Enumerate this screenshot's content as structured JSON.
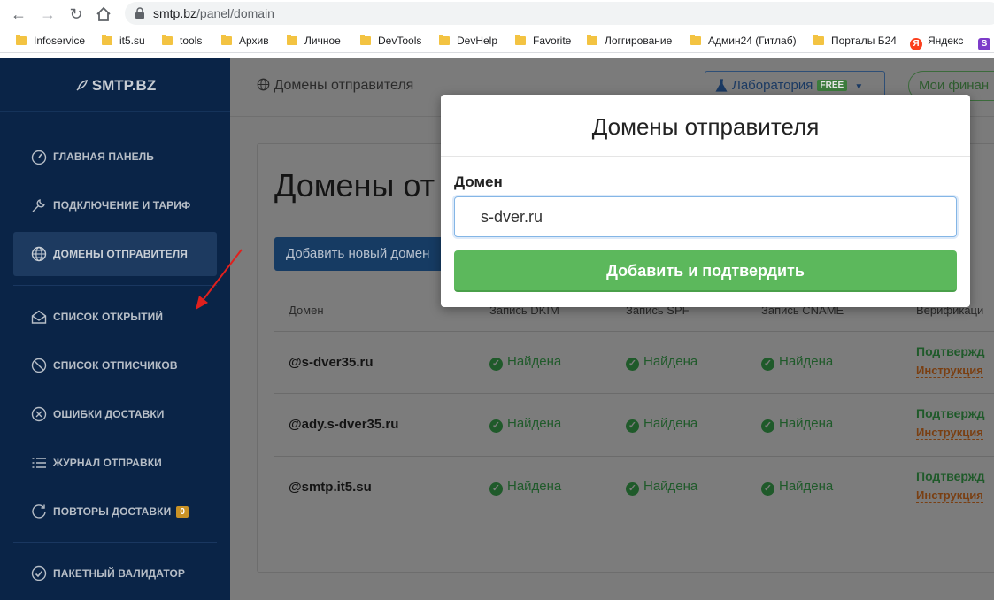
{
  "browser": {
    "url_host": "smtp.bz",
    "url_path": "/panel/domain",
    "bookmarks": [
      {
        "label": "Infoservice",
        "type": "folder"
      },
      {
        "label": "it5.su",
        "type": "folder"
      },
      {
        "label": "tools",
        "type": "folder"
      },
      {
        "label": "Архив",
        "type": "folder"
      },
      {
        "label": "Личное",
        "type": "folder"
      },
      {
        "label": "DevTools",
        "type": "folder"
      },
      {
        "label": "DevHelp",
        "type": "folder"
      },
      {
        "label": "Favorite",
        "type": "folder"
      },
      {
        "label": "Логгирование",
        "type": "folder"
      },
      {
        "label": "Админ24 (Гитлаб)",
        "type": "folder"
      },
      {
        "label": "Порталы Б24",
        "type": "folder"
      },
      {
        "label": "Яндекс",
        "type": "yandex"
      }
    ]
  },
  "sidebar": {
    "logo": "SMTP.BZ",
    "items": [
      {
        "label": "ГЛАВНАЯ ПАНЕЛЬ",
        "icon": "gauge-icon"
      },
      {
        "label": "ПОДКЛЮЧЕНИЕ И ТАРИФ",
        "icon": "wrench-icon"
      },
      {
        "label": "ДОМЕНЫ ОТПРАВИТЕЛЯ",
        "icon": "globe-icon",
        "active": true
      },
      {
        "label": "СПИСОК ОТКРЫТИЙ",
        "icon": "envelope-open-icon"
      },
      {
        "label": "СПИСОК ОТПИСЧИКОВ",
        "icon": "ban-icon"
      },
      {
        "label": "ОШИБКИ ДОСТАВКИ",
        "icon": "x-circle-icon"
      },
      {
        "label": "ЖУРНАЛ ОТПРАВКИ",
        "icon": "list-icon"
      },
      {
        "label": "ПОВТОРЫ ДОСТАВКИ",
        "icon": "redo-icon",
        "badge": "0"
      },
      {
        "label": "ПАКЕТНЫЙ ВАЛИДАТОР",
        "icon": "check-circle-icon"
      }
    ]
  },
  "topbar": {
    "breadcrumb": "Домены отправителя",
    "lab_label": "Лаборатория",
    "lab_badge": "FREE",
    "finance_label": "Мои финан"
  },
  "main": {
    "title": "Домены от",
    "add_button": "Добавить новый домен",
    "columns": [
      "Домен",
      "Запись DKIM",
      "Запись SPF",
      "Запись CNAME",
      "Верификаци"
    ],
    "rows": [
      {
        "domain": "@s-dver35.ru",
        "dkim": "Найдена",
        "spf": "Найдена",
        "cname": "Найдена",
        "status": "Подтвержд",
        "link": "Инструкция"
      },
      {
        "domain": "@ady.s-dver35.ru",
        "dkim": "Найдена",
        "spf": "Найдена",
        "cname": "Найдена",
        "status": "Подтвержд",
        "link": "Инструкция"
      },
      {
        "domain": "@smtp.it5.su",
        "dkim": "Найдена",
        "spf": "Найдена",
        "cname": "Найдена",
        "status": "Подтвержд",
        "link": "Инструкция"
      }
    ]
  },
  "modal": {
    "title": "Домены отправителя",
    "field_label": "Домен",
    "field_value": "s-dver.ru",
    "submit": "Добавить и подтвердить"
  },
  "colors": {
    "sidebar_bg": "#0a2447",
    "overlay": "#7b7b7b",
    "success": "#5cb85c",
    "annotation_arrow": "#e0201d"
  }
}
